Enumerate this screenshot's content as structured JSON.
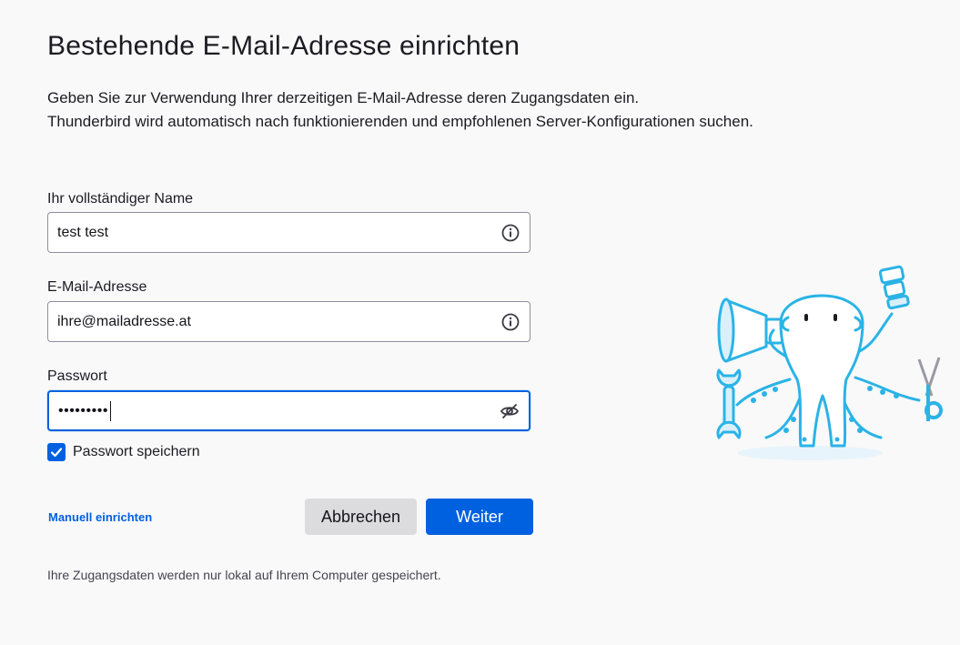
{
  "header": {
    "title": "Bestehende E-Mail-Adresse einrichten",
    "intro_line1": "Geben Sie zur Verwendung Ihrer derzeitigen E-Mail-Adresse deren Zugangsdaten ein.",
    "intro_line2": "Thunderbird wird automatisch nach funktionierenden und empfohlenen Server-Konfigurationen suchen."
  },
  "form": {
    "name": {
      "label": "Ihr vollständiger Name",
      "value": "test test",
      "icon": "info-icon"
    },
    "email": {
      "label": "E-Mail-Adresse",
      "value": "ihre@mailadresse.at",
      "icon": "info-icon"
    },
    "password": {
      "label": "Passwort",
      "masked_value": "•••••••••",
      "icon": "eye-slash-icon"
    },
    "remember_password": {
      "label": "Passwort speichern",
      "checked": true
    }
  },
  "actions": {
    "manual_link": "Manuell einrichten",
    "cancel_label": "Abbrechen",
    "next_label": "Weiter"
  },
  "footer": {
    "note": "Ihre Zugangsdaten werden nur lokal auf Ihrem Computer gespeichert."
  },
  "colors": {
    "accent": "#0061e0",
    "background": "#f9f9fa",
    "mascot_blue": "#2bb3e6",
    "mascot_light": "#d9f0fb"
  }
}
